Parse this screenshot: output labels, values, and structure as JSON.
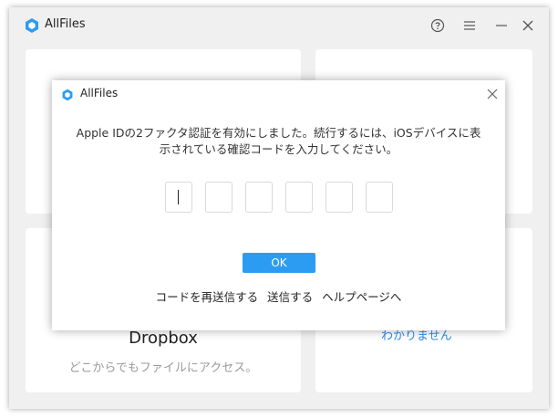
{
  "app": {
    "title": "AllFiles",
    "accent_color": "#2c9cf2",
    "logo_icon": "hexagon-cube-icon"
  },
  "titlebar": {
    "buttons": [
      {
        "name": "help-icon"
      },
      {
        "name": "menu-icon"
      },
      {
        "name": "minimize-icon"
      },
      {
        "name": "close-icon"
      }
    ]
  },
  "cards": {
    "dropbox": {
      "title": "Dropbox",
      "subtitle": "どこからでもファイルにアクセス。"
    },
    "right_bottom": {
      "link_text": "わかりません"
    }
  },
  "dialog": {
    "title": "AllFiles",
    "message_line1": "Apple IDの2ファクタ認証を有効にしました。続行するには、iOSデバイスに表",
    "message_line2": "示されている確認コードを入力してください。",
    "code_boxes": [
      "",
      "",
      "",
      "",
      "",
      ""
    ],
    "ok_label": "OK",
    "links": {
      "resend_code": "コードを再送信する",
      "send": "送信する",
      "help_page": "ヘルプページへ"
    }
  }
}
